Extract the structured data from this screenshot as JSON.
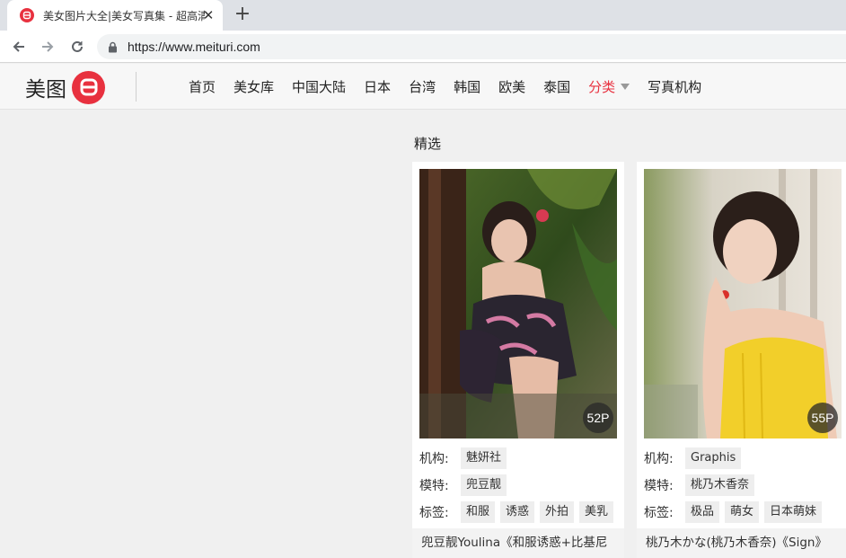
{
  "browser": {
    "tab_title": "美女图片大全|美女写真集 - 超高清",
    "url": "https://www.meituri.com"
  },
  "site": {
    "brand_text": "美图",
    "brand_color": "#e8313f",
    "nav": [
      "首页",
      "美女库",
      "中国大陆",
      "日本",
      "台湾",
      "韩国",
      "欧美",
      "泰国",
      "分类",
      "写真机构"
    ],
    "active_nav": "分类"
  },
  "main": {
    "section_title": "精选",
    "labels": {
      "org": "机构:",
      "model": "模特:",
      "tags": "标签:"
    },
    "cards": [
      {
        "count": "52P",
        "org": "魅妍社",
        "model": "兜豆靓",
        "tags": [
          "和服",
          "诱惑",
          "外拍",
          "美乳"
        ],
        "caption": "兜豆靓Youlina《和服诱惑+比基尼"
      },
      {
        "count": "55P",
        "org": "Graphis",
        "model": "桃乃木香奈",
        "tags": [
          "极品",
          "萌女",
          "日本萌妹"
        ],
        "caption": "桃乃木かな(桃乃木香奈)《Sign》"
      }
    ]
  },
  "icons": {
    "favicon": "meituri-logo-icon",
    "new_tab": "plus-icon",
    "back": "arrow-left-icon",
    "forward": "arrow-right-icon",
    "reload": "reload-icon",
    "lock": "lock-icon",
    "dropdown": "caret-down-icon"
  }
}
